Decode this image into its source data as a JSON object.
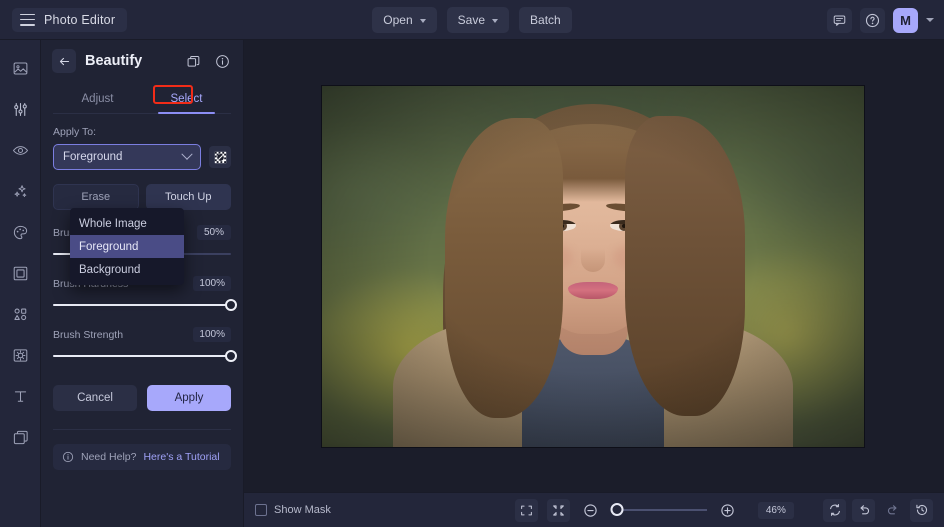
{
  "app": {
    "brand_label": "Photo Editor",
    "menu_icon": "hamburger-icon"
  },
  "topbar": {
    "open_label": "Open",
    "save_label": "Save",
    "batch_label": "Batch",
    "feedback_icon": "comment-icon",
    "help_icon": "question-circle-icon",
    "avatar_initial": "M"
  },
  "left_rail": {
    "items": [
      {
        "name": "image-icon",
        "label": "Image"
      },
      {
        "name": "adjust-sliders-icon",
        "label": "Adjust"
      },
      {
        "name": "eye-icon",
        "label": "Retouch"
      },
      {
        "name": "sparkles-icon",
        "label": "Effects"
      },
      {
        "name": "palette-icon",
        "label": "Color"
      },
      {
        "name": "frame-icon",
        "label": "Frame"
      },
      {
        "name": "shapes-icon",
        "label": "Shapes"
      },
      {
        "name": "texture-icon",
        "label": "Texture"
      },
      {
        "name": "text-icon",
        "label": "Text"
      },
      {
        "name": "layers-icon",
        "label": "Layers"
      }
    ]
  },
  "panel": {
    "back_icon": "arrow-left-icon",
    "title": "Beautify",
    "copy_icon": "duplicate-icon",
    "info_icon": "info-circle-icon",
    "tabs": [
      {
        "label": "Adjust",
        "active": false
      },
      {
        "label": "Select",
        "active": true,
        "highlighted": true
      }
    ],
    "apply_to": {
      "label": "Apply To:",
      "value": "Foreground",
      "mask_icon": "mask-tool-icon",
      "options": [
        {
          "label": "Whole Image",
          "selected": false
        },
        {
          "label": "Foreground",
          "selected": true
        },
        {
          "label": "Background",
          "selected": false
        }
      ]
    },
    "segmented": [
      {
        "label": "Erase",
        "active": false
      },
      {
        "label": "Touch Up",
        "active": true
      }
    ],
    "sliders": [
      {
        "label": "Brush Size",
        "value": "50%",
        "percent": 50
      },
      {
        "label": "Brush Hardness",
        "value": "100%",
        "percent": 100
      },
      {
        "label": "Brush Strength",
        "value": "100%",
        "percent": 100
      }
    ],
    "cancel_label": "Cancel",
    "apply_label": "Apply",
    "help": {
      "icon": "info-circle-icon",
      "text": "Need Help?",
      "link": "Here's a Tutorial"
    }
  },
  "bottombar": {
    "show_mask_label": "Show Mask",
    "show_mask_checked": false,
    "fit_icon": "fit-screen-icon",
    "actual_icon": "shrink-icon",
    "zoom_out_icon": "minus-circle-icon",
    "zoom_in_icon": "plus-circle-icon",
    "zoom_value": "46%",
    "zoom_percent": 12,
    "compare_icon": "compare-icon",
    "undo_icon": "undo-icon",
    "redo_icon": "redo-icon",
    "history_icon": "history-icon"
  },
  "colors": {
    "accent": "#a7a8fb",
    "highlight": "#f22c18",
    "panel_bg": "#20233a",
    "topbar_bg": "#23263a",
    "canvas_bg": "#1b1d2a"
  }
}
